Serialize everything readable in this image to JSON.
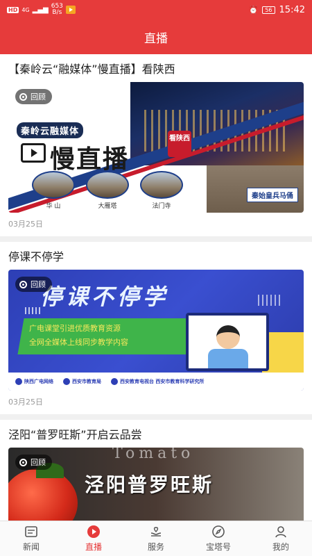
{
  "statusbar": {
    "net_tag": "HD",
    "net_gen": "4G",
    "speed_value": "653",
    "speed_unit": "B/s",
    "battery": "56",
    "time": "15:42"
  },
  "navbar": {
    "title": "直播"
  },
  "feed": {
    "items": [
      {
        "title": "【秦岭云“融媒体”慢直播】看陕西",
        "badge": "回顾",
        "date": "03月25日",
        "thumb": {
          "brand": "秦岭云融媒体",
          "headline": "慢直播",
          "seal": "看陕西",
          "spots": [
            "华 山",
            "大雁塔",
            "法门寺"
          ],
          "corner_label": "秦始皇兵马俑"
        }
      },
      {
        "title": "停课不停学",
        "badge": "回顾",
        "date": "03月25日",
        "thumb": {
          "headline": "停课不停学",
          "line1": "广电课堂引进优质教育资源",
          "line2": "全网全媒体上线同步教学内容",
          "logos": [
            "陕西广电网络",
            "西安市教育局",
            "西安教育电视台 西安市教育科学研究所"
          ]
        }
      },
      {
        "title": "泾阳“普罗旺斯”开启云品尝",
        "badge": "回顾",
        "thumb": {
          "overlay_en": "Tomato",
          "headline": "泾阳普罗旺斯"
        }
      }
    ]
  },
  "tabbar": {
    "tabs": [
      {
        "label": "新闻",
        "icon": "news-icon",
        "active": false
      },
      {
        "label": "直播",
        "icon": "live-play-icon",
        "active": true
      },
      {
        "label": "服务",
        "icon": "service-hand-icon",
        "active": false
      },
      {
        "label": "宝塔号",
        "icon": "compass-icon",
        "active": false
      },
      {
        "label": "我的",
        "icon": "profile-icon",
        "active": false
      }
    ]
  },
  "colors": {
    "brand_red": "#e63b3b",
    "text": "#222222",
    "muted": "#999999"
  }
}
